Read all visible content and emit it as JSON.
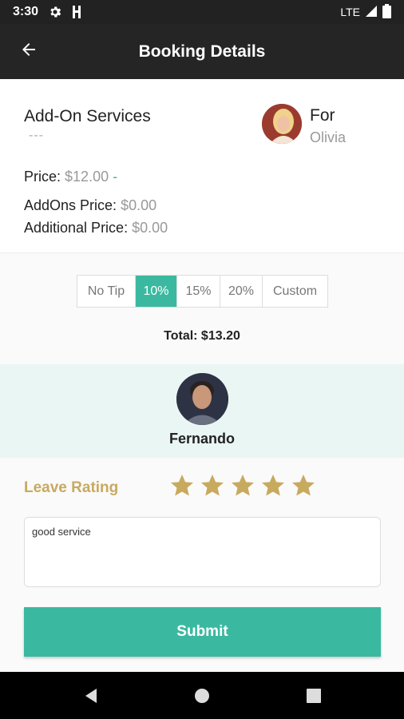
{
  "status_bar": {
    "time": "3:30",
    "network": "LTE"
  },
  "app_bar": {
    "title": "Booking Details",
    "back_icon": "arrow-left-icon"
  },
  "service": {
    "title": "Add-On Services",
    "placeholder": "---",
    "for_label": "For",
    "client_name": "Olivia",
    "price_label": "Price:",
    "price_value": "$12.00",
    "price_dash": "-",
    "addons_label": "AddOns Price:",
    "addons_value": "$0.00",
    "additional_label": "Additional Price:",
    "additional_value": "$0.00"
  },
  "tips": {
    "options": [
      "No Tip",
      "10%",
      "15%",
      "20%",
      "Custom"
    ],
    "selected": "10%"
  },
  "total": "Total: $13.20",
  "stylist": {
    "name": "Fernando"
  },
  "rating": {
    "label": "Leave Rating",
    "stars": 5,
    "max": 5,
    "star_color": "#c8aa5f"
  },
  "comment": {
    "value": "good service"
  },
  "submit": {
    "label": "Submit"
  },
  "colors": {
    "accent": "#3bb9a0",
    "gold": "#c8aa5f",
    "app_bar": "#252525"
  }
}
